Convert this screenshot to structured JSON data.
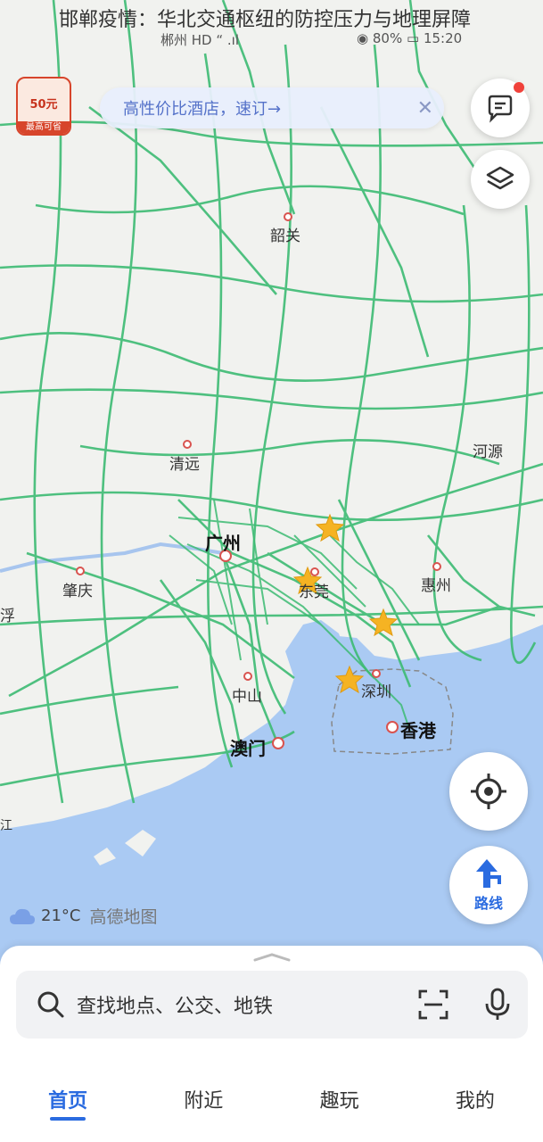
{
  "overlay_title": "邯郸疫情：华北交通枢纽的防控压力与地理屏障",
  "status_bar": {
    "left_text": "郴州 HD “ .ıl",
    "battery": "80%",
    "time": "15:20"
  },
  "promo": {
    "amount": "50元",
    "tag": "最高可省"
  },
  "hotel_banner": {
    "text": "高性价比酒店，速订→",
    "close_icon": "close-icon"
  },
  "buttons": {
    "message_icon": "message-icon",
    "layers_icon": "layers-icon",
    "locate_icon": "locate-icon",
    "route_label": "路线"
  },
  "cities": {
    "shaoguan": "韶关",
    "qingyuan": "清远",
    "heyuan": "河源",
    "guangzhou": "广州",
    "zhaoqing": "肇庆",
    "dongguan": "东莞",
    "huizhou": "惠州",
    "fu": "浮",
    "zhongshan": "中山",
    "shenzhen": "深圳",
    "xianggang": "香港",
    "aomen": "澳门",
    "jiang": "江"
  },
  "weather": {
    "temperature": "21°C",
    "brand": "高德地图"
  },
  "search": {
    "placeholder": "查找地点、公交、地铁"
  },
  "tabs": [
    "首页",
    "附近",
    "趣玩",
    "我的"
  ],
  "colors": {
    "accent": "#2a6be0",
    "road": "#3dbb73",
    "sea": "#a9c9f2",
    "land": "#f2f3f0",
    "star": "#f5b323"
  }
}
